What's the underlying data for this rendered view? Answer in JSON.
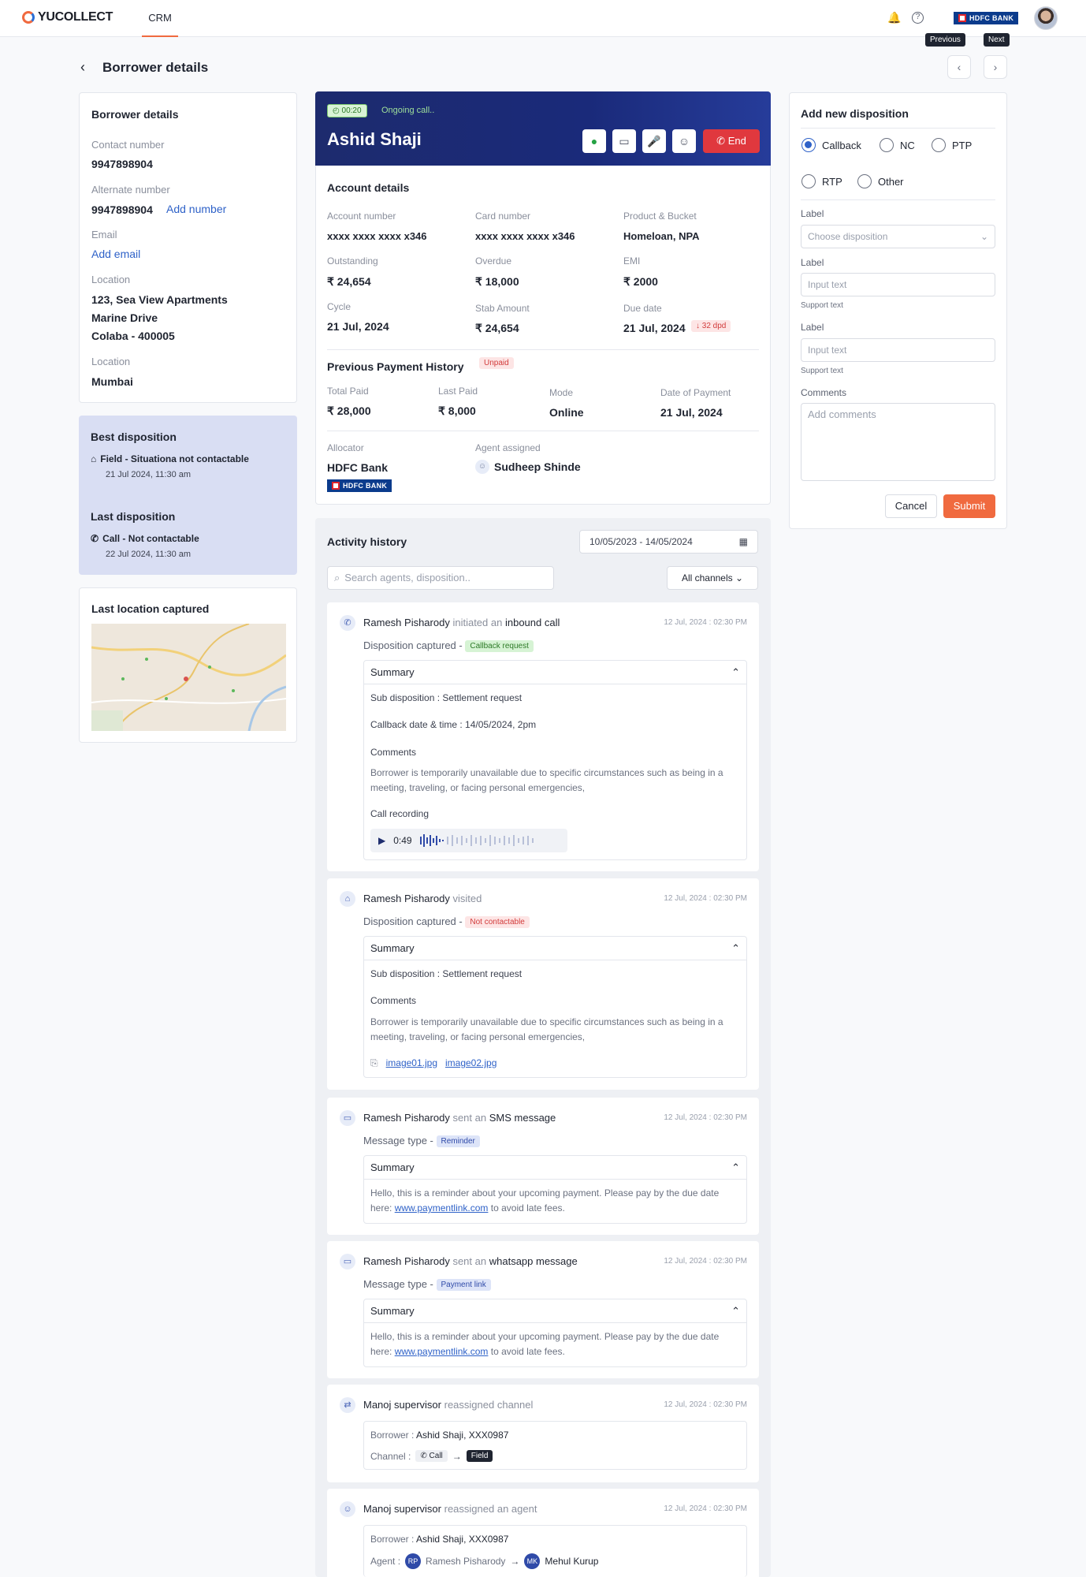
{
  "app": {
    "brand": "YUCOLLECT",
    "nav_tab": "CRM",
    "bank_badge": "HDFC BANK"
  },
  "header": {
    "title": "Borrower details",
    "prev_tooltip": "Previous",
    "next_tooltip": "Next"
  },
  "borrower": {
    "title": "Borrower details",
    "contact_label": "Contact number",
    "contact_value": "9947898904",
    "alt_label": "Alternate number",
    "alt_value": "9947898904",
    "add_number": "Add number",
    "email_label": "Email",
    "add_email": "Add email",
    "location_label": "Location",
    "address_1": "123, Sea View Apartments",
    "address_2": "Marine Drive",
    "address_3": "Colaba - 400005",
    "location2_label": "Location",
    "city": "Mumbai"
  },
  "dispositions": {
    "best_title": "Best disposition",
    "best_value": "Field - Situationa not contactable",
    "best_time": "21 Jul 2024, 11:30 am",
    "last_title": "Last disposition",
    "last_value": "Call - Not contactable",
    "last_time": "22 Jul 2024, 11:30 am"
  },
  "location_card": {
    "title": "Last location captured"
  },
  "call": {
    "timer": "00:20",
    "status": "Ongoing call..",
    "name": "Ashid Shaji",
    "end_label": "End"
  },
  "account": {
    "title": "Account details",
    "account_number_label": "Account number",
    "account_number": "xxxx xxxx xxxx x346",
    "card_number_label": "Card number",
    "card_number": "xxxx xxxx xxxx x346",
    "product_label": "Product & Bucket",
    "product": "Homeloan, NPA",
    "outstanding_label": "Outstanding",
    "outstanding": "₹ 24,654",
    "overdue_label": "Overdue",
    "overdue": "₹ 18,000",
    "emi_label": "EMI",
    "emi": "₹ 2000",
    "cycle_label": "Cycle",
    "cycle": "21 Jul, 2024",
    "stab_label": "Stab Amount",
    "stab": "₹ 24,654",
    "due_label": "Due date",
    "due": "21 Jul, 2024",
    "dpd": "↓ 32 dpd"
  },
  "payment": {
    "title": "Previous Payment History",
    "status": "Unpaid",
    "total_label": "Total Paid",
    "total": "₹ 28,000",
    "last_label": "Last Paid",
    "last": "₹ 8,000",
    "mode_label": "Mode",
    "mode": "Online",
    "date_label": "Date of Payment",
    "date": "21 Jul, 2024",
    "allocator_label": "Allocator",
    "allocator": "HDFC Bank",
    "agent_label": "Agent assigned",
    "agent": "Sudheep Shinde"
  },
  "activity": {
    "title": "Activity history",
    "date_range": "10/05/2023 - 14/05/2024",
    "search_placeholder": "Search agents, disposition..",
    "channel_filter": "All channels",
    "e1": {
      "actor": "Ramesh Pisharody",
      "verb": "initiated an",
      "obj": "inbound call",
      "time": "12 Jul, 2024 : 02:30 PM",
      "disp_label": "Disposition captured -",
      "disp": "Callback request",
      "summary": "Summary",
      "subdisp": "Sub disposition : Settlement request",
      "callback": "Callback date & time : 14/05/2024, 2pm",
      "comments_label": "Comments",
      "comments": "Borrower is temporarily unavailable due to specific circumstances such as being in a meeting, traveling, or facing personal emergencies,",
      "recording_label": "Call recording",
      "duration": "0:49"
    },
    "e2": {
      "actor": "Ramesh Pisharody",
      "verb": "visited",
      "time": "12 Jul, 2024 : 02:30 PM",
      "disp_label": "Disposition captured -",
      "disp": "Not contactable",
      "summary": "Summary",
      "subdisp": "Sub disposition : Settlement request",
      "comments_label": "Comments",
      "comments": "Borrower is temporarily unavailable due to specific circumstances such as being in a meeting, traveling, or facing personal emergencies,",
      "file1": "image01.jpg",
      "file2": "image02.jpg"
    },
    "e3": {
      "actor": "Ramesh Pisharody",
      "verb": "sent an",
      "obj": "SMS message",
      "time": "12 Jul, 2024 : 02:30 PM",
      "type_label": "Message type -",
      "type": "Reminder",
      "summary": "Summary",
      "msg_1": "Hello, this is a reminder about your upcoming payment. Please pay by the",
      "msg_2": "due date here:",
      "msg_link": "www.paymentlink.com",
      "msg_3": "to avoid late fees."
    },
    "e4": {
      "actor": "Ramesh Pisharody",
      "verb": "sent an",
      "obj": "whatsapp message",
      "time": "12 Jul, 2024 : 02:30 PM",
      "type_label": "Message type -",
      "type": "Payment link",
      "summary": "Summary",
      "msg_1": "Hello, this is a reminder about your upcoming payment. Please pay by the",
      "msg_2": "due date here:",
      "msg_link": "www.paymentlink.com",
      "msg_3": "to avoid late fees."
    },
    "e5": {
      "actor": "Manoj supervisor",
      "verb": "reassigned channel",
      "time": "12 Jul, 2024 : 02:30 PM",
      "borrower_label": "Borrower :",
      "borrower": "Ashid Shaji, XXX0987",
      "channel_label": "Channel :",
      "from": "Call",
      "to": "Field"
    },
    "e6": {
      "actor": "Manoj supervisor",
      "verb": "reassigned an agent",
      "time": "12 Jul, 2024 : 02:30 PM",
      "borrower_label": "Borrower :",
      "borrower": "Ashid Shaji, XXX0987",
      "agent_label": "Agent :",
      "from_initials": "RP",
      "from": "Ramesh Pisharody",
      "to_initials": "MK",
      "to": "Mehul Kurup"
    }
  },
  "new_disposition": {
    "title": "Add new disposition",
    "options": [
      "Callback",
      "NC",
      "PTP",
      "RTP",
      "Other"
    ],
    "label_1": "Label",
    "select_placeholder": "Choose disposition",
    "label_2": "Label",
    "input_1_placeholder": "Input text",
    "support_1": "Support text",
    "label_3": "Label",
    "input_2_placeholder": "Input text",
    "support_2": "Support text",
    "comments_label": "Comments",
    "comments_placeholder": "Add comments",
    "cancel": "Cancel",
    "submit": "Submit"
  },
  "colors": {
    "accent": "#f06a3f",
    "primary": "#2f62c8",
    "call_header": "#1d2b6e",
    "disposition_bg": "#d9def3"
  }
}
